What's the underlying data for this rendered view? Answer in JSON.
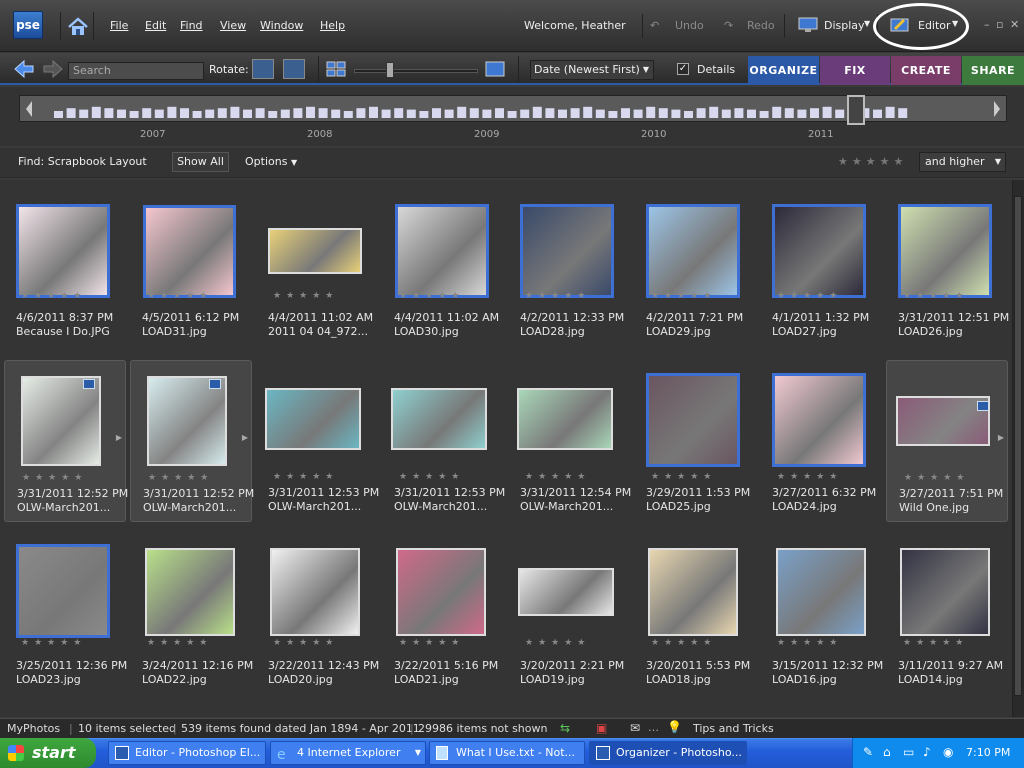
{
  "app": {
    "logo": "pse",
    "welcome": "Welcome, Heather"
  },
  "menu": [
    "File",
    "Edit",
    "Find",
    "View",
    "Window",
    "Help"
  ],
  "toolbar": {
    "undo": "Undo",
    "redo": "Redo",
    "display": "Display",
    "editor": "Editor"
  },
  "toolbar2": {
    "search_placeholder": "Search",
    "rotate_label": "Rotate:",
    "sort": "Date (Newest First)",
    "details_label": "Details",
    "details_checked": true
  },
  "tabs": [
    {
      "label": "ORGANIZE",
      "color": "#2c58a8"
    },
    {
      "label": "FIX",
      "color": "#6a3d7a"
    },
    {
      "label": "CREATE",
      "color": "#7a3d6a"
    },
    {
      "label": "SHARE",
      "color": "#3d7a3d"
    }
  ],
  "timeline": {
    "years": [
      "2007",
      "2008",
      "2009",
      "2010",
      "2011"
    ]
  },
  "find_bar": {
    "label": "Find: Scrapbook Layout",
    "show_all": "Show All",
    "options": "Options",
    "rating_filter": "and higher"
  },
  "photos": [
    {
      "date": "4/6/2011 8:37 PM",
      "name": "Because I Do.JPG"
    },
    {
      "date": "4/5/2011 6:12 PM",
      "name": "LOAD31.jpg"
    },
    {
      "date": "4/4/2011 11:02 AM",
      "name": "2011 04 04_972..."
    },
    {
      "date": "4/4/2011 11:02 AM",
      "name": "LOAD30.jpg"
    },
    {
      "date": "4/2/2011 12:33 PM",
      "name": "LOAD28.jpg"
    },
    {
      "date": "4/2/2011 7:21 PM",
      "name": "LOAD29.jpg"
    },
    {
      "date": "4/1/2011 1:32 PM",
      "name": "LOAD27.jpg"
    },
    {
      "date": "3/31/2011 12:51 PM",
      "name": "LOAD26.jpg"
    },
    {
      "date": "3/31/2011 12:52 PM",
      "name": "OLW-March201..."
    },
    {
      "date": "3/31/2011 12:52 PM",
      "name": "OLW-March201..."
    },
    {
      "date": "3/31/2011 12:53 PM",
      "name": "OLW-March201..."
    },
    {
      "date": "3/31/2011 12:53 PM",
      "name": "OLW-March201..."
    },
    {
      "date": "3/31/2011 12:54 PM",
      "name": "OLW-March201..."
    },
    {
      "date": "3/29/2011 1:53 PM",
      "name": "LOAD25.jpg"
    },
    {
      "date": "3/27/2011 6:32 PM",
      "name": "LOAD24.jpg"
    },
    {
      "date": "3/27/2011 7:51 PM",
      "name": "Wild One.jpg"
    },
    {
      "date": "3/25/2011 12:36 PM",
      "name": "LOAD23.jpg"
    },
    {
      "date": "3/24/2011 12:16 PM",
      "name": "LOAD22.jpg"
    },
    {
      "date": "3/22/2011 12:43 PM",
      "name": "LOAD20.jpg"
    },
    {
      "date": "3/22/2011 5:16 PM",
      "name": "LOAD21.jpg"
    },
    {
      "date": "3/20/2011 2:21 PM",
      "name": "LOAD19.jpg"
    },
    {
      "date": "3/20/2011 5:53 PM",
      "name": "LOAD18.jpg"
    },
    {
      "date": "3/15/2011 12:32 PM",
      "name": "LOAD16.jpg"
    },
    {
      "date": "3/11/2011 9:27 AM",
      "name": "LOAD14.jpg"
    }
  ],
  "status": {
    "catalog": "MyPhotos",
    "selected": "10 items selected",
    "found": "539 items found dated Jan 1894 - Apr 2011",
    "not_shown": "29986 items not shown",
    "tips": "Tips and Tricks"
  },
  "taskbar": {
    "start": "start",
    "tasks": [
      "Editor - Photoshop El...",
      "4 Internet Explorer",
      "What I Use.txt - Not...",
      "Organizer - Photosho..."
    ],
    "clock": "7:10 PM"
  }
}
